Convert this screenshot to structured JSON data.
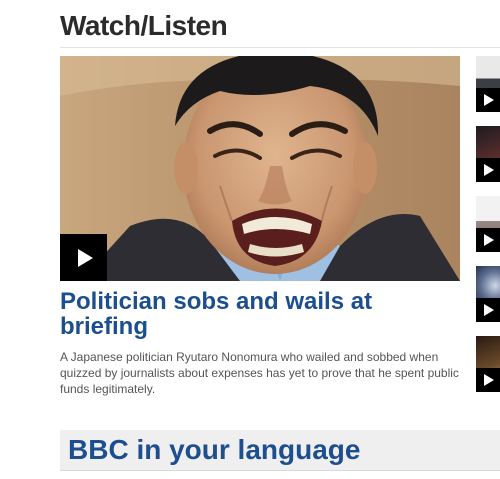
{
  "watch": {
    "section_title": "Watch/Listen",
    "featured": {
      "headline": "Politician sobs and wails at briefing",
      "summary": "A Japanese politician Ryutaro Nonomura who wailed and sobbed when quizzed by journalists about expenses has yet to prove that he spent public funds legitimately.",
      "icon": "play-icon"
    },
    "side_items": [
      {
        "icon": "play-icon",
        "tone": "#3a3f45"
      },
      {
        "icon": "play-icon",
        "tone": "#5a2e2a"
      },
      {
        "icon": "play-icon",
        "tone": "#9a8a86"
      },
      {
        "icon": "play-icon",
        "tone": "#1b2a4a"
      },
      {
        "icon": "play-icon",
        "tone": "#6b4a2a"
      }
    ]
  },
  "language": {
    "title": "BBC in your language"
  },
  "colors": {
    "headline": "#1d4f8f",
    "title": "#2b2b2b",
    "summary": "#555555",
    "language_band": "#efefef"
  }
}
